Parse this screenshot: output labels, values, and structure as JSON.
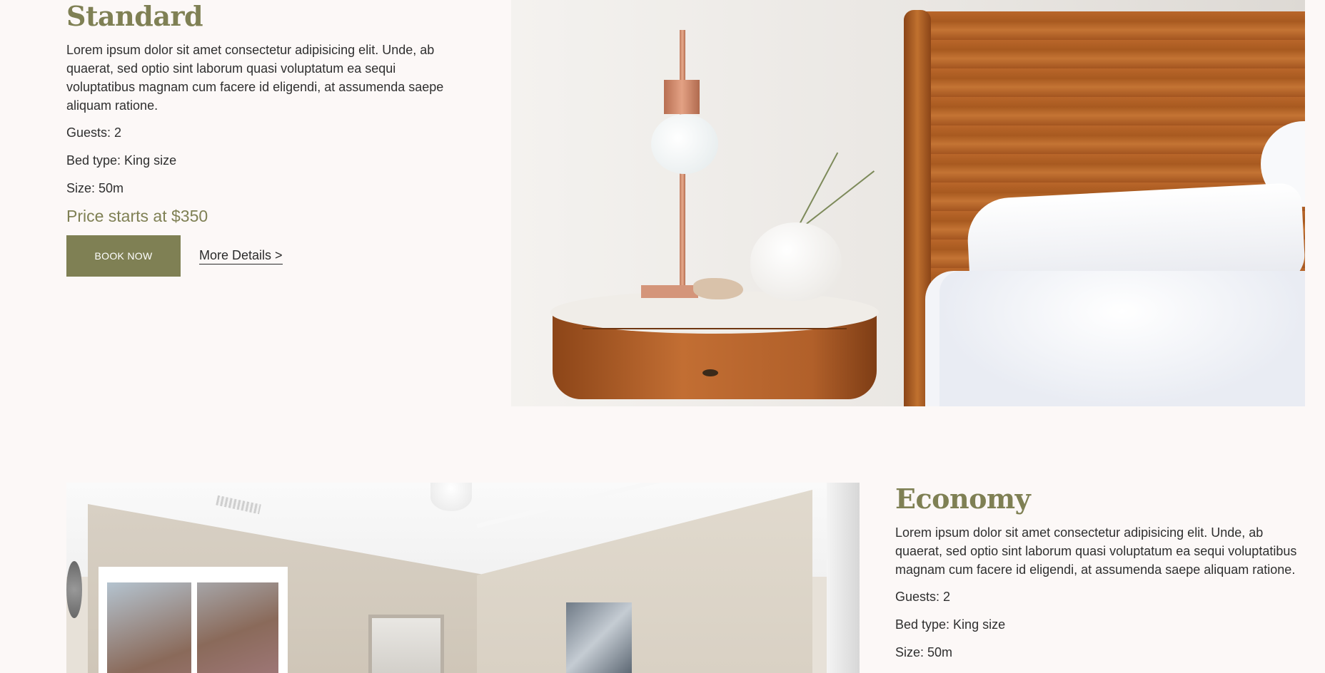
{
  "rooms": [
    {
      "title": "Standard",
      "description": "Lorem ipsum dolor sit amet consectetur adipisicing elit. Unde, ab quaerat, sed optio sint laborum quasi voluptatum ea sequi voluptatibus magnam cum facere id eligendi, at assumenda saepe aliquam ratione.",
      "guests": "Guests: 2",
      "bed_type": "Bed type: King size",
      "size": "Size: 50m",
      "price": "Price starts at $350",
      "book_label": "BOOK NOW",
      "details_label": "More Details >"
    },
    {
      "title": "Economy",
      "description": "Lorem ipsum dolor sit amet consectetur adipisicing elit. Unde, ab quaerat, sed optio sint laborum quasi voluptatum ea sequi voluptatibus magnam cum facere id eligendi, at assumenda saepe aliquam ratione.",
      "guests": "Guests: 2",
      "bed_type": "Bed type: King size",
      "size": "Size: 50m"
    }
  ],
  "colors": {
    "accent": "#7f8054",
    "background": "#fcf8f7",
    "text": "#2b2b2b"
  }
}
